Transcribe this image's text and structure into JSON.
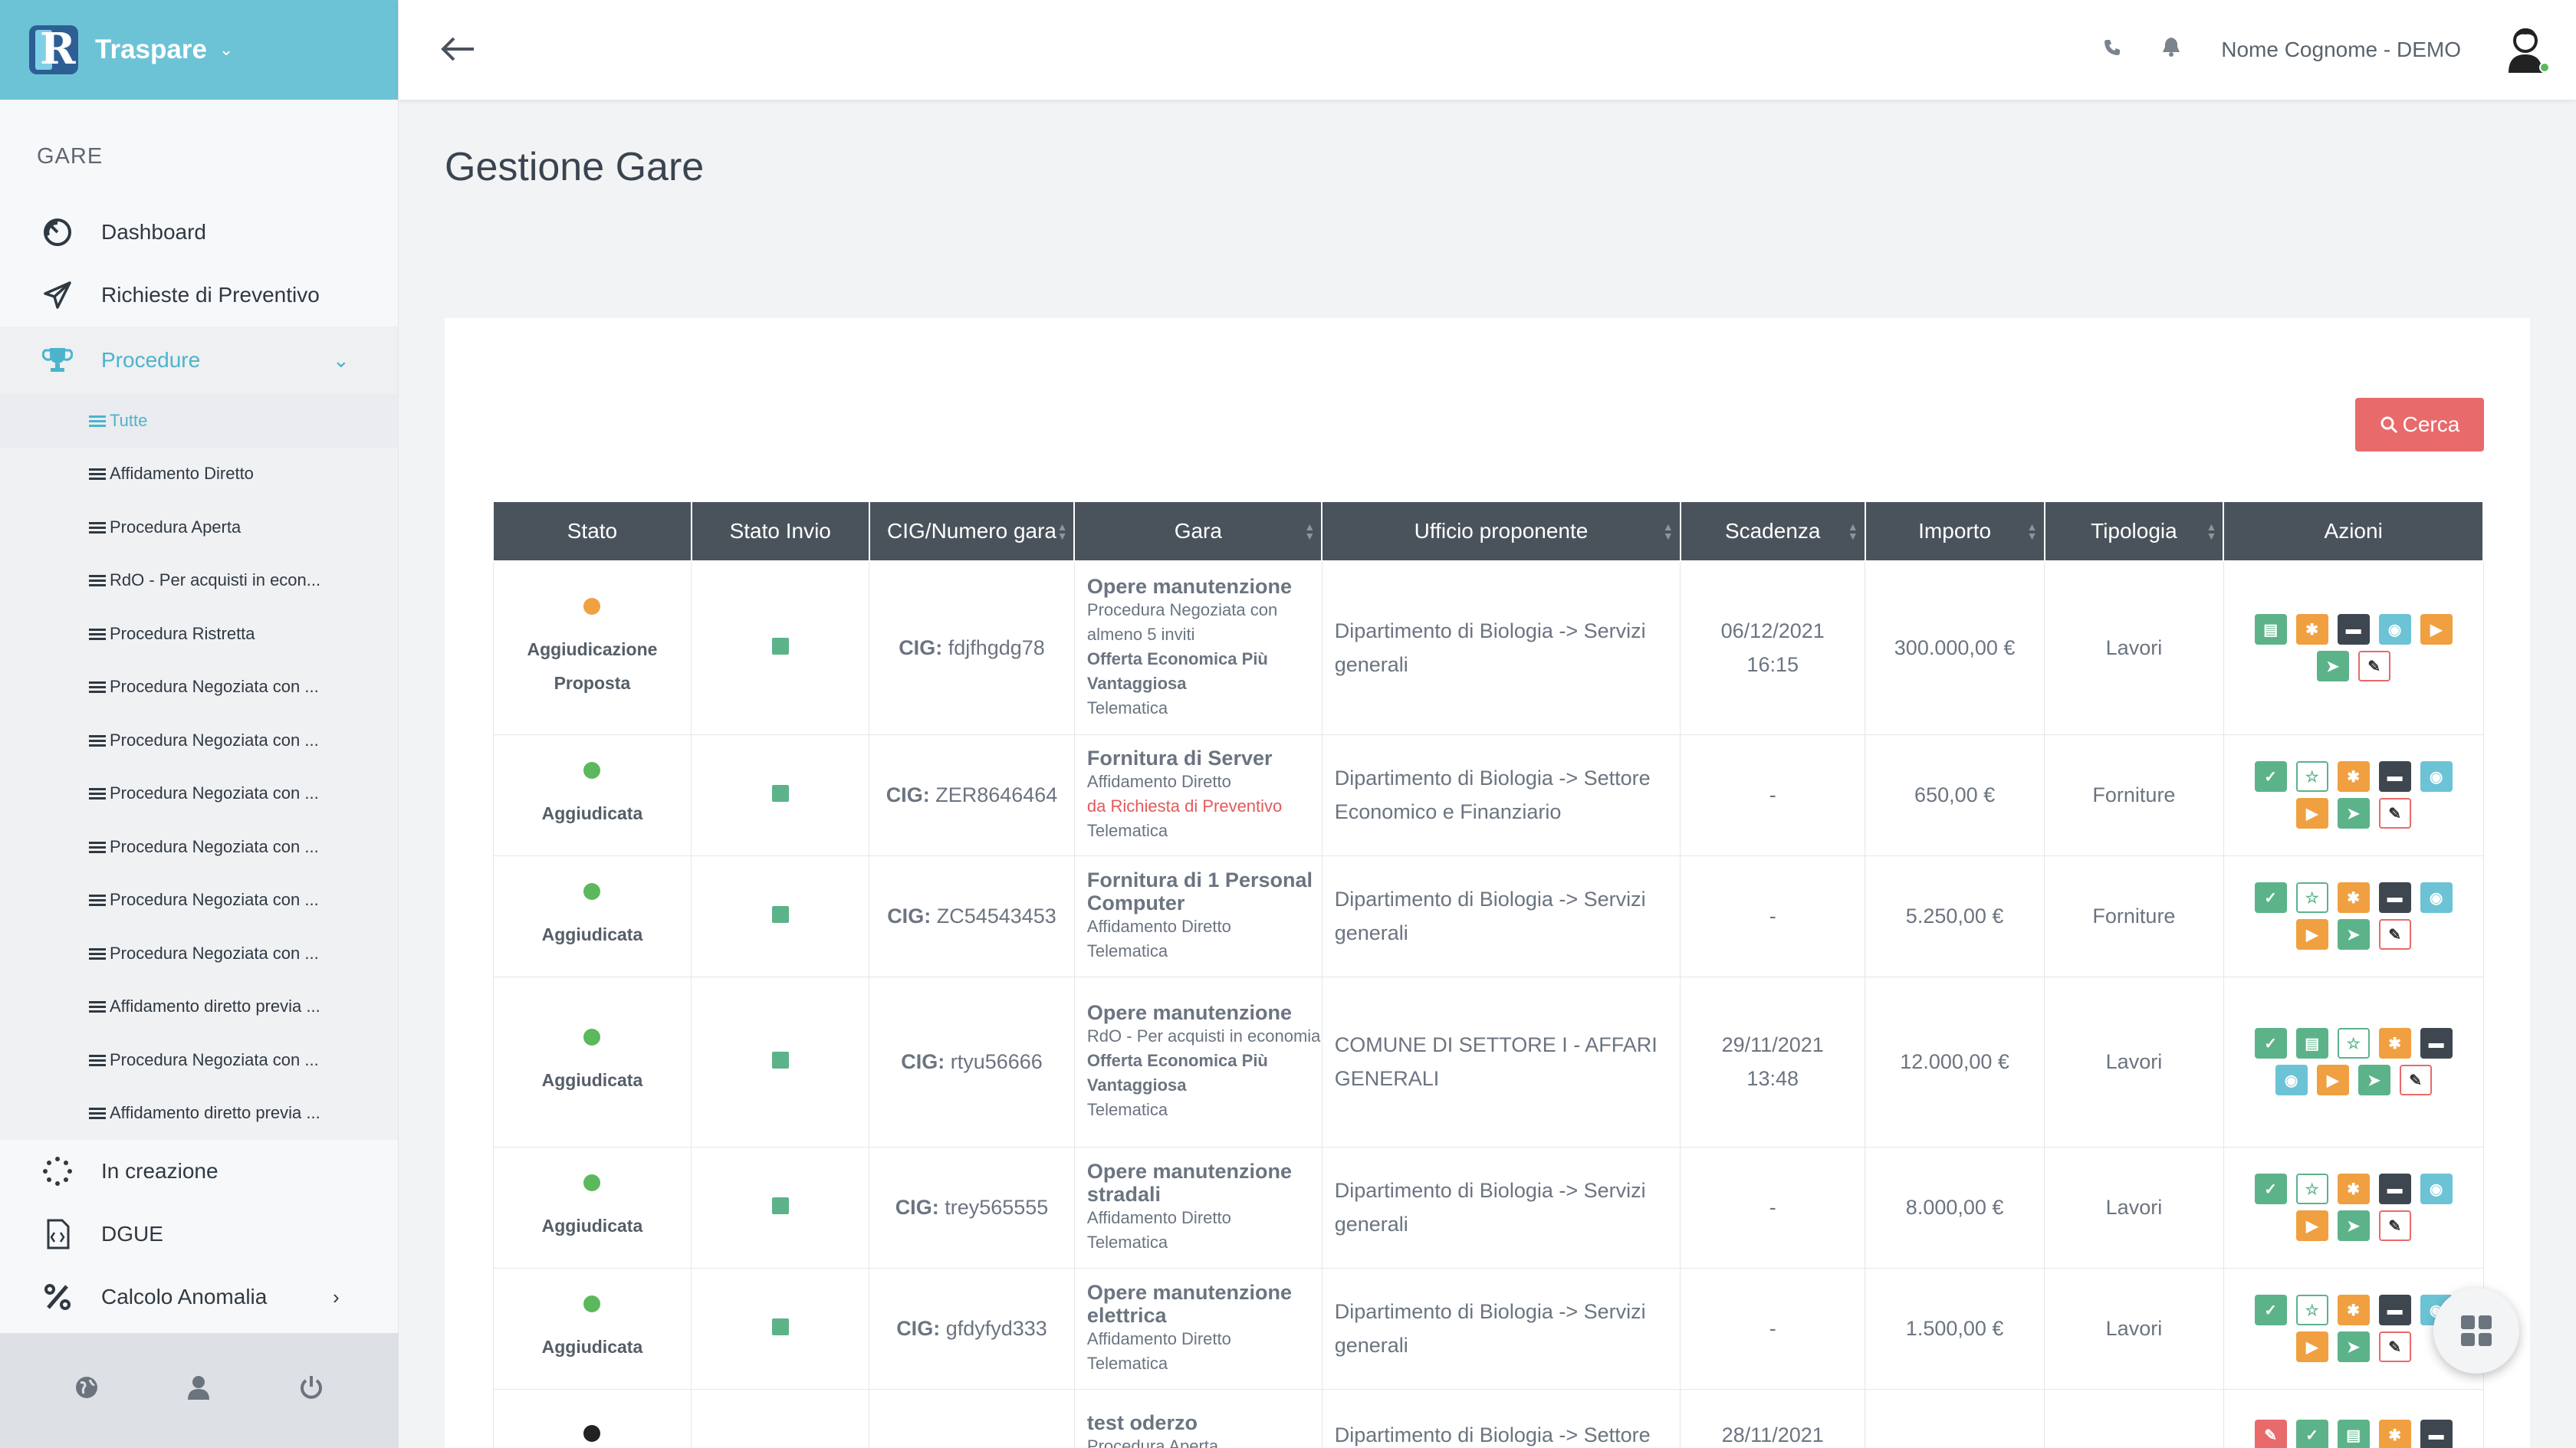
{
  "brand": {
    "name": "Traspare",
    "logo_letter": "R"
  },
  "sidebar": {
    "section_title": "GARE",
    "items": [
      {
        "label": "Dashboard",
        "icon": "dashboard-icon"
      },
      {
        "label": "Richieste di Preventivo",
        "icon": "paper-plane-icon"
      },
      {
        "label": "Procedure",
        "icon": "trophy-icon"
      }
    ],
    "sub_items": [
      "Tutte",
      "Affidamento Diretto",
      "Procedura Aperta",
      "RdO - Per acquisti in econ...",
      "Procedura Ristretta",
      "Procedura Negoziata con ...",
      "Procedura Negoziata con ...",
      "Procedura Negoziata con ...",
      "Procedura Negoziata con ...",
      "Procedura Negoziata con ...",
      "Procedura Negoziata con ...",
      "Affidamento diretto previa ...",
      "Procedura Negoziata con ...",
      "Affidamento diretto previa ..."
    ],
    "bottom_items": [
      {
        "label": "In creazione",
        "icon": "spinner-icon"
      },
      {
        "label": "DGUE",
        "icon": "code-file-icon"
      },
      {
        "label": "Calcolo Anomalia",
        "icon": "percent-icon"
      }
    ]
  },
  "topbar": {
    "username": "Nome Cognome - DEMO"
  },
  "page": {
    "title": "Gestione Gare",
    "search_button": "Cerca"
  },
  "table": {
    "headers": [
      "Stato",
      "Stato Invio",
      "CIG/Numero gara",
      "Gara",
      "Ufficio proponente",
      "Scadenza",
      "Importo",
      "Tipologia",
      "Azioni"
    ],
    "cig_prefix": "CIG:",
    "rows": [
      {
        "status": "Aggiudicazione Proposta",
        "status_color": "#f0a040",
        "cig": "fdjfhgdg78",
        "gara_title": "Opere manutenzione",
        "gara_proc": "Procedura Negoziata con almeno 5 inviti",
        "gara_extra": "Offerta Economica Più Vantaggiosa",
        "gara_extra_style": "bold",
        "gara_mode": "Telematica",
        "ufficio": "Dipartimento di Biologia -> Servizi generali",
        "scadenza": "06/12/2021 16:15",
        "importo": "300.000,00 €",
        "tipologia": "Lavori"
      },
      {
        "status": "Aggiudicata",
        "status_color": "#5cb85c",
        "cig": "ZER8646464",
        "gara_title": "Fornitura di Server",
        "gara_proc": "Affidamento Diretto",
        "gara_extra": "da Richiesta di Preventivo",
        "gara_extra_style": "red",
        "gara_mode": "Telematica",
        "ufficio": "Dipartimento di Biologia -> Settore Economico e Finanziario",
        "scadenza": "-",
        "importo": "650,00 €",
        "tipologia": "Forniture"
      },
      {
        "status": "Aggiudicata",
        "status_color": "#5cb85c",
        "cig": "ZC54543453",
        "gara_title": "Fornitura di 1 Personal Computer",
        "gara_proc": "Affidamento Diretto",
        "gara_extra": "",
        "gara_extra_style": "",
        "gara_mode": "Telematica",
        "ufficio": "Dipartimento di Biologia -> Servizi generali",
        "scadenza": "-",
        "importo": "5.250,00 €",
        "tipologia": "Forniture"
      },
      {
        "status": "Aggiudicata",
        "status_color": "#5cb85c",
        "cig": "rtyu56666",
        "gara_title": "Opere manutenzione",
        "gara_proc": "RdO - Per acquisti in economia",
        "gara_extra": "Offerta Economica Più Vantaggiosa",
        "gara_extra_style": "bold",
        "gara_mode": "Telematica",
        "ufficio": "COMUNE DI SETTORE I - AFFARI GENERALI",
        "scadenza": "29/11/2021 13:48",
        "importo": "12.000,00 €",
        "tipologia": "Lavori"
      },
      {
        "status": "Aggiudicata",
        "status_color": "#5cb85c",
        "cig": "trey565555",
        "gara_title": "Opere manutenzione stradali",
        "gara_proc": "Affidamento Diretto",
        "gara_extra": "",
        "gara_extra_style": "",
        "gara_mode": "Telematica",
        "ufficio": "Dipartimento di Biologia -> Servizi generali",
        "scadenza": "-",
        "importo": "8.000,00 €",
        "tipologia": "Lavori"
      },
      {
        "status": "Aggiudicata",
        "status_color": "#5cb85c",
        "cig": "gfdyfyd333",
        "gara_title": "Opere manutenzione elettrica",
        "gara_proc": "Affidamento Diretto",
        "gara_extra": "",
        "gara_extra_style": "",
        "gara_mode": "Telematica",
        "ufficio": "Dipartimento di Biologia -> Servizi generali",
        "scadenza": "-",
        "importo": "1.500,00 €",
        "tipologia": "Lavori"
      },
      {
        "status": "",
        "status_color": "#222222",
        "cig": "",
        "gara_title": "test oderzo",
        "gara_proc": "Procedura Aperta",
        "gara_extra": "",
        "gara_extra_style": "",
        "gara_mode": "",
        "ufficio": "Dipartimento di Biologia -> Settore",
        "scadenza": "28/11/2021",
        "importo": "",
        "tipologia": ""
      }
    ],
    "actions": [
      [
        "file-icon:green",
        "gear-icon:orange",
        "folder-icon:dark",
        "eye-icon:teal",
        "play-icon:orange",
        "send-icon:green",
        "wrench-icon:outr"
      ],
      [
        "check-icon:green",
        "star-icon:outg",
        "gear-icon:orange",
        "folder-icon:dark",
        "eye-icon:teal",
        "play-icon:orange",
        "send-icon:green",
        "wrench-icon:outr"
      ],
      [
        "check-icon:green",
        "star-icon:outg",
        "gear-icon:orange",
        "folder-icon:dark",
        "eye-icon:teal",
        "play-icon:orange",
        "send-icon:green",
        "wrench-icon:outr"
      ],
      [
        "check-icon:green",
        "file-icon:green",
        "star-icon:outg",
        "gear-icon:orange",
        "folder-icon:dark",
        "eye-icon:teal",
        "play-icon:orange",
        "send-icon:green",
        "wrench-icon:outr"
      ],
      [
        "check-icon:green",
        "star-icon:outg",
        "gear-icon:orange",
        "folder-icon:dark",
        "eye-icon:teal",
        "play-icon:orange",
        "send-icon:green",
        "wrench-icon:outr"
      ],
      [
        "check-icon:green",
        "star-icon:outg",
        "gear-icon:orange",
        "folder-icon:dark",
        "eye-icon:teal",
        "play-icon:orange",
        "send-icon:green",
        "wrench-icon:outr"
      ],
      [
        "edit-icon:red",
        "check-icon:green",
        "file-icon:green",
        "gear-icon:orange",
        "folder-icon:dark"
      ]
    ]
  },
  "colors": {
    "accent": "#6cc3d6",
    "header": "#4a535c",
    "danger": "#e86a6a",
    "success": "#5cb38a",
    "warning": "#f0a040"
  }
}
